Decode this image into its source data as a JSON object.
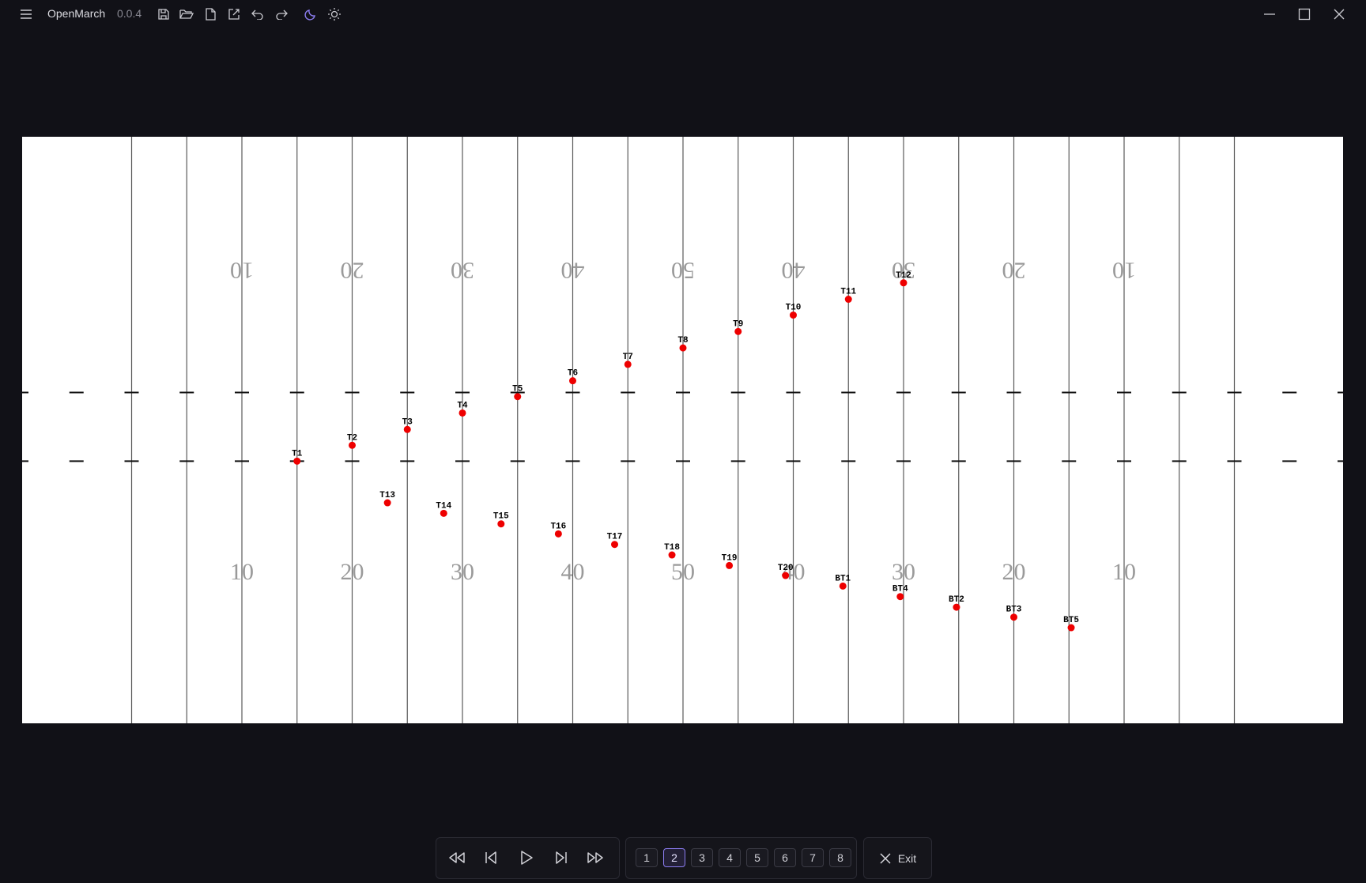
{
  "app": {
    "name": "OpenMarch",
    "version": "0.0.4"
  },
  "toolbar": {
    "icons": [
      "save-icon",
      "open-folder-icon",
      "new-file-icon",
      "export-icon",
      "undo-icon",
      "redo-icon",
      "dark-mode-icon",
      "light-mode-icon"
    ]
  },
  "window_controls": [
    "minimize-icon",
    "maximize-icon",
    "close-icon"
  ],
  "field": {
    "yard_numbers_top": [
      "10",
      "20",
      "30",
      "40",
      "50",
      "40",
      "30",
      "20",
      "10"
    ],
    "yard_numbers_bottom": [
      "10",
      "20",
      "30",
      "40",
      "50",
      "40",
      "30",
      "20",
      "10"
    ],
    "marchers": [
      {
        "label": "T1",
        "yard": -35,
        "y": 0.553
      },
      {
        "label": "T2",
        "yard": -30,
        "y": 0.526
      },
      {
        "label": "T3",
        "yard": -25,
        "y": 0.499
      },
      {
        "label": "T4",
        "yard": -20,
        "y": 0.471
      },
      {
        "label": "T5",
        "yard": -15,
        "y": 0.443
      },
      {
        "label": "T6",
        "yard": -10,
        "y": 0.416
      },
      {
        "label": "T7",
        "yard": -5,
        "y": 0.388
      },
      {
        "label": "T8",
        "yard": 0,
        "y": 0.36
      },
      {
        "label": "T9",
        "yard": 5,
        "y": 0.332
      },
      {
        "label": "T10",
        "yard": 10,
        "y": 0.304
      },
      {
        "label": "T11",
        "yard": 15,
        "y": 0.277
      },
      {
        "label": "T12",
        "yard": 20,
        "y": 0.249
      },
      {
        "label": "T13",
        "yard": -26.8,
        "y": 0.624
      },
      {
        "label": "T14",
        "yard": -21.7,
        "y": 0.642
      },
      {
        "label": "T15",
        "yard": -16.5,
        "y": 0.66
      },
      {
        "label": "T16",
        "yard": -11.3,
        "y": 0.677
      },
      {
        "label": "T17",
        "yard": -6.2,
        "y": 0.695
      },
      {
        "label": "T18",
        "yard": -1.0,
        "y": 0.713
      },
      {
        "label": "T19",
        "yard": 4.2,
        "y": 0.731
      },
      {
        "label": "T20",
        "yard": 9.3,
        "y": 0.748
      },
      {
        "label": "BT1",
        "yard": 14.5,
        "y": 0.766
      },
      {
        "label": "BT4",
        "yard": 19.7,
        "y": 0.784
      },
      {
        "label": "BT2",
        "yard": 24.8,
        "y": 0.802
      },
      {
        "label": "BT3",
        "yard": 30.0,
        "y": 0.819
      },
      {
        "label": "BT5",
        "yard": 35.2,
        "y": 0.837
      }
    ]
  },
  "playback": {
    "buttons": [
      "rewind-icon",
      "previous-page-icon",
      "play-icon",
      "next-page-icon",
      "fast-forward-icon"
    ]
  },
  "pages": {
    "labels": [
      "1",
      "2",
      "3",
      "4",
      "5",
      "6",
      "7",
      "8"
    ],
    "selected": "2"
  },
  "exit_label": "Exit",
  "colors": {
    "accent": "#8b7cf0",
    "marcher": "#ee0000",
    "background": "#111117"
  }
}
